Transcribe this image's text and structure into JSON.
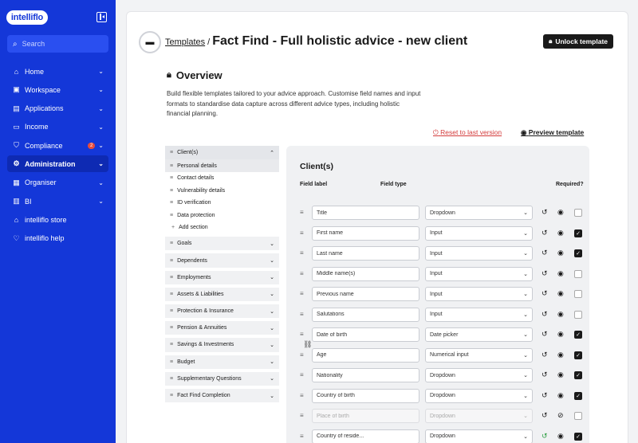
{
  "app": {
    "logo": "intelliflo"
  },
  "search": {
    "placeholder": "Search"
  },
  "nav": [
    {
      "label": "Home",
      "icon": "home-icon",
      "glyph": "⌂",
      "badge": ""
    },
    {
      "label": "Workspace",
      "icon": "workspace-icon",
      "glyph": "▣",
      "badge": ""
    },
    {
      "label": "Applications",
      "icon": "applications-icon",
      "glyph": "▤",
      "badge": ""
    },
    {
      "label": "Income",
      "icon": "income-icon",
      "glyph": "▭",
      "badge": ""
    },
    {
      "label": "Compliance",
      "icon": "shield-icon",
      "glyph": "⛉",
      "badge": "2"
    },
    {
      "label": "Administration",
      "icon": "gear-icon",
      "glyph": "⚙",
      "badge": ""
    },
    {
      "label": "Organiser",
      "icon": "calendar-icon",
      "glyph": "▦",
      "badge": ""
    },
    {
      "label": "BI",
      "icon": "chart-icon",
      "glyph": "▥",
      "badge": ""
    },
    {
      "label": "intelliflo store",
      "icon": "store-icon",
      "glyph": "⌂",
      "badge": ""
    },
    {
      "label": "intelliflo help",
      "icon": "help-icon",
      "glyph": "♡",
      "badge": ""
    }
  ],
  "header": {
    "crumb": "Templates",
    "separator": "/",
    "title": "Fact Find - Full holistic advice - new client",
    "unlock_label": "Unlock template"
  },
  "overview": {
    "title": "Overview",
    "description": "Build flexible templates tailored to your advice approach. Customise field names and input formats to standardise data capture across different advice types, including holistic financial planning."
  },
  "actions": {
    "reset": "Reset to last version",
    "preview": "Preview template"
  },
  "sections": {
    "open": "Client(s)",
    "subsections": [
      "Personal details",
      "Contact details",
      "Vulnerability details",
      "ID verification",
      "Data protection"
    ],
    "add_label": "Add section",
    "others": [
      "Goals",
      "Dependents",
      "Employments",
      "Assets & Liabilities",
      "Protection & Insurance",
      "Pension & Annuities",
      "Savings & Investments",
      "Budget",
      "Supplementary Questions",
      "Fact Find Completion"
    ]
  },
  "panel": {
    "title": "Client(s)",
    "col_label": "Field label",
    "col_type": "Field type",
    "col_required": "Required?",
    "fields": [
      {
        "label": "Title",
        "type": "Dropdown",
        "required": false,
        "disabled": false,
        "hidden": false,
        "changed": false
      },
      {
        "label": "First name",
        "type": "Input",
        "required": true,
        "disabled": false,
        "hidden": false,
        "changed": false
      },
      {
        "label": "Last name",
        "type": "Input",
        "required": true,
        "disabled": false,
        "hidden": false,
        "changed": false
      },
      {
        "label": "Middle name(s)",
        "type": "Input",
        "required": false,
        "disabled": false,
        "hidden": false,
        "changed": false
      },
      {
        "label": "Previous name",
        "type": "Input",
        "required": false,
        "disabled": false,
        "hidden": false,
        "changed": false
      },
      {
        "label": "Salutations",
        "type": "Input",
        "required": false,
        "disabled": false,
        "hidden": false,
        "changed": false
      },
      {
        "label": "Date of birth",
        "type": "Date picker",
        "required": true,
        "disabled": false,
        "hidden": false,
        "changed": false
      },
      {
        "label": "Age",
        "type": "Numerical input",
        "required": true,
        "disabled": false,
        "hidden": false,
        "changed": false
      },
      {
        "label": "Nationality",
        "type": "Dropdown",
        "required": true,
        "disabled": false,
        "hidden": false,
        "changed": false
      },
      {
        "label": "Country of birth",
        "type": "Dropdown",
        "required": true,
        "disabled": false,
        "hidden": false,
        "changed": false
      },
      {
        "label": "Place of birth",
        "type": "Dropdown",
        "required": false,
        "disabled": true,
        "hidden": true,
        "changed": false
      },
      {
        "label": "Country of reside...",
        "type": "Dropdown",
        "required": true,
        "disabled": false,
        "hidden": false,
        "changed": true
      },
      {
        "label": "",
        "type": "",
        "required": false,
        "disabled": false,
        "hidden": false,
        "changed": false
      }
    ]
  }
}
